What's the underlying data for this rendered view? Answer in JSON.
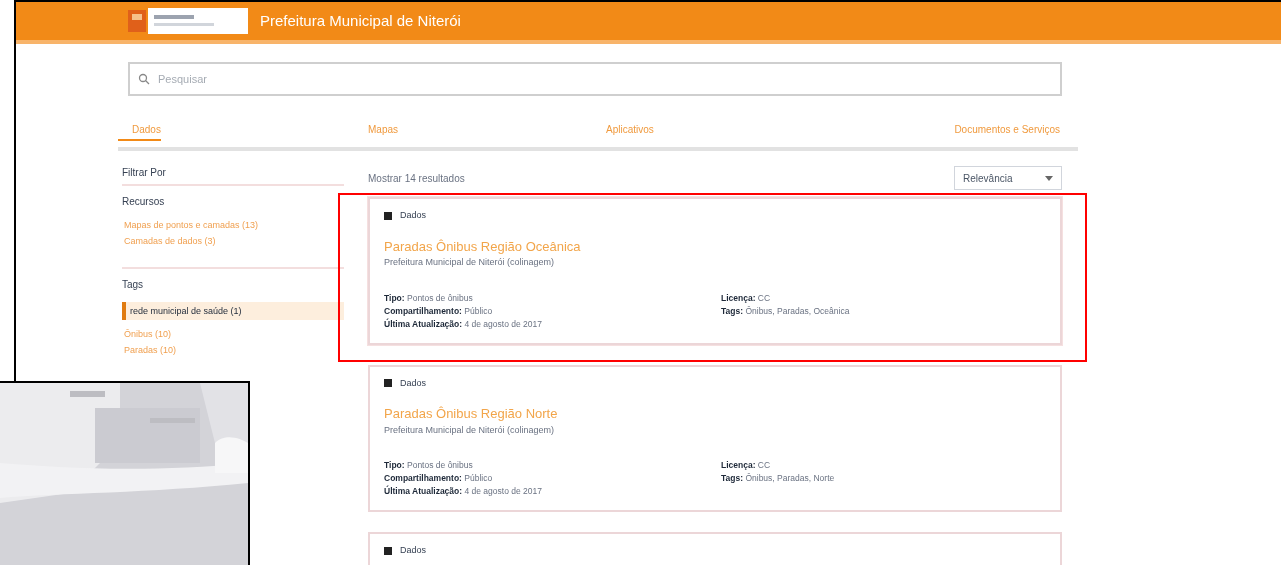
{
  "header": {
    "title": "Prefeitura Municipal de Niterói"
  },
  "search": {
    "placeholder": "Pesquisar"
  },
  "tabs": [
    {
      "label": "Dados",
      "selected": true
    },
    {
      "label": "Mapas",
      "selected": false
    },
    {
      "label": "Aplicativos",
      "selected": false
    },
    {
      "label": "Documentos e Serviços",
      "selected": false
    }
  ],
  "sidebar": {
    "filter_title": "Filtrar Por",
    "groups": [
      {
        "title": "Recursos",
        "items": [
          {
            "label": "Mapas de pontos e camadas (13)",
            "selected": false
          },
          {
            "label": "Camadas de dados (3)",
            "selected": false
          }
        ]
      },
      {
        "title": "Tags",
        "items": [
          {
            "label": "rede municipal de saúde (1)",
            "selected": true
          },
          {
            "label": "Ônibus (10)",
            "selected": false
          },
          {
            "label": "Paradas (10)",
            "selected": false
          }
        ]
      }
    ]
  },
  "results": {
    "count": "Mostrar 14 resultados",
    "sort": "Relevância"
  },
  "cards": [
    {
      "type": "Dados",
      "title": "Paradas Ônibus Região Oceânica",
      "subtitle": "Prefeitura Municipal de Niterói (colinagem)",
      "left_fields": [
        {
          "label": "Tipo:",
          "value": "Pontos de ônibus"
        },
        {
          "label": "Compartilhamento:",
          "value": "Público"
        },
        {
          "label": "Última Atualização:",
          "value": "4 de agosto de 2017"
        }
      ],
      "right_fields": [
        {
          "label": "Licença:",
          "value": "CC"
        },
        {
          "label": "Tags:",
          "value": "Ônibus, Paradas, Oceânica"
        }
      ],
      "highlighted": true
    },
    {
      "type": "Dados",
      "title": "Paradas Ônibus Região Norte",
      "subtitle": "Prefeitura Municipal de Niterói (colinagem)",
      "left_fields": [
        {
          "label": "Tipo:",
          "value": "Pontos de ônibus"
        },
        {
          "label": "Compartilhamento:",
          "value": "Público"
        },
        {
          "label": "Última Atualização:",
          "value": "4 de agosto de 2017"
        }
      ],
      "right_fields": [
        {
          "label": "Licença:",
          "value": "CC"
        },
        {
          "label": "Tags:",
          "value": "Ônibus, Paradas, Norte"
        }
      ],
      "highlighted": false
    },
    {
      "type": "Dados",
      "highlighted": false
    }
  ]
}
